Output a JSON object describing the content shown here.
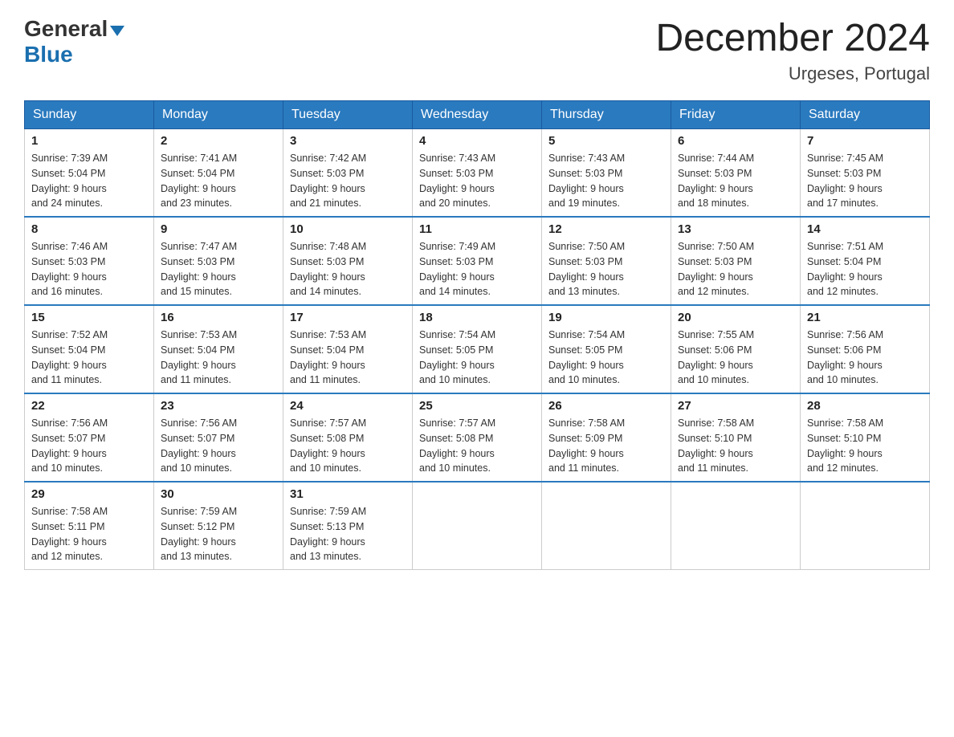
{
  "header": {
    "logo_general": "General",
    "logo_blue": "Blue",
    "month_title": "December 2024",
    "location": "Urgeses, Portugal"
  },
  "weekdays": [
    "Sunday",
    "Monday",
    "Tuesday",
    "Wednesday",
    "Thursday",
    "Friday",
    "Saturday"
  ],
  "weeks": [
    [
      {
        "day": "1",
        "sunrise": "7:39 AM",
        "sunset": "5:04 PM",
        "daylight": "9 hours and 24 minutes."
      },
      {
        "day": "2",
        "sunrise": "7:41 AM",
        "sunset": "5:04 PM",
        "daylight": "9 hours and 23 minutes."
      },
      {
        "day": "3",
        "sunrise": "7:42 AM",
        "sunset": "5:03 PM",
        "daylight": "9 hours and 21 minutes."
      },
      {
        "day": "4",
        "sunrise": "7:43 AM",
        "sunset": "5:03 PM",
        "daylight": "9 hours and 20 minutes."
      },
      {
        "day": "5",
        "sunrise": "7:43 AM",
        "sunset": "5:03 PM",
        "daylight": "9 hours and 19 minutes."
      },
      {
        "day": "6",
        "sunrise": "7:44 AM",
        "sunset": "5:03 PM",
        "daylight": "9 hours and 18 minutes."
      },
      {
        "day": "7",
        "sunrise": "7:45 AM",
        "sunset": "5:03 PM",
        "daylight": "9 hours and 17 minutes."
      }
    ],
    [
      {
        "day": "8",
        "sunrise": "7:46 AM",
        "sunset": "5:03 PM",
        "daylight": "9 hours and 16 minutes."
      },
      {
        "day": "9",
        "sunrise": "7:47 AM",
        "sunset": "5:03 PM",
        "daylight": "9 hours and 15 minutes."
      },
      {
        "day": "10",
        "sunrise": "7:48 AM",
        "sunset": "5:03 PM",
        "daylight": "9 hours and 14 minutes."
      },
      {
        "day": "11",
        "sunrise": "7:49 AM",
        "sunset": "5:03 PM",
        "daylight": "9 hours and 14 minutes."
      },
      {
        "day": "12",
        "sunrise": "7:50 AM",
        "sunset": "5:03 PM",
        "daylight": "9 hours and 13 minutes."
      },
      {
        "day": "13",
        "sunrise": "7:50 AM",
        "sunset": "5:03 PM",
        "daylight": "9 hours and 12 minutes."
      },
      {
        "day": "14",
        "sunrise": "7:51 AM",
        "sunset": "5:04 PM",
        "daylight": "9 hours and 12 minutes."
      }
    ],
    [
      {
        "day": "15",
        "sunrise": "7:52 AM",
        "sunset": "5:04 PM",
        "daylight": "9 hours and 11 minutes."
      },
      {
        "day": "16",
        "sunrise": "7:53 AM",
        "sunset": "5:04 PM",
        "daylight": "9 hours and 11 minutes."
      },
      {
        "day": "17",
        "sunrise": "7:53 AM",
        "sunset": "5:04 PM",
        "daylight": "9 hours and 11 minutes."
      },
      {
        "day": "18",
        "sunrise": "7:54 AM",
        "sunset": "5:05 PM",
        "daylight": "9 hours and 10 minutes."
      },
      {
        "day": "19",
        "sunrise": "7:54 AM",
        "sunset": "5:05 PM",
        "daylight": "9 hours and 10 minutes."
      },
      {
        "day": "20",
        "sunrise": "7:55 AM",
        "sunset": "5:06 PM",
        "daylight": "9 hours and 10 minutes."
      },
      {
        "day": "21",
        "sunrise": "7:56 AM",
        "sunset": "5:06 PM",
        "daylight": "9 hours and 10 minutes."
      }
    ],
    [
      {
        "day": "22",
        "sunrise": "7:56 AM",
        "sunset": "5:07 PM",
        "daylight": "9 hours and 10 minutes."
      },
      {
        "day": "23",
        "sunrise": "7:56 AM",
        "sunset": "5:07 PM",
        "daylight": "9 hours and 10 minutes."
      },
      {
        "day": "24",
        "sunrise": "7:57 AM",
        "sunset": "5:08 PM",
        "daylight": "9 hours and 10 minutes."
      },
      {
        "day": "25",
        "sunrise": "7:57 AM",
        "sunset": "5:08 PM",
        "daylight": "9 hours and 10 minutes."
      },
      {
        "day": "26",
        "sunrise": "7:58 AM",
        "sunset": "5:09 PM",
        "daylight": "9 hours and 11 minutes."
      },
      {
        "day": "27",
        "sunrise": "7:58 AM",
        "sunset": "5:10 PM",
        "daylight": "9 hours and 11 minutes."
      },
      {
        "day": "28",
        "sunrise": "7:58 AM",
        "sunset": "5:10 PM",
        "daylight": "9 hours and 12 minutes."
      }
    ],
    [
      {
        "day": "29",
        "sunrise": "7:58 AM",
        "sunset": "5:11 PM",
        "daylight": "9 hours and 12 minutes."
      },
      {
        "day": "30",
        "sunrise": "7:59 AM",
        "sunset": "5:12 PM",
        "daylight": "9 hours and 13 minutes."
      },
      {
        "day": "31",
        "sunrise": "7:59 AM",
        "sunset": "5:13 PM",
        "daylight": "9 hours and 13 minutes."
      },
      null,
      null,
      null,
      null
    ]
  ],
  "labels": {
    "sunrise": "Sunrise:",
    "sunset": "Sunset:",
    "daylight": "Daylight:"
  }
}
